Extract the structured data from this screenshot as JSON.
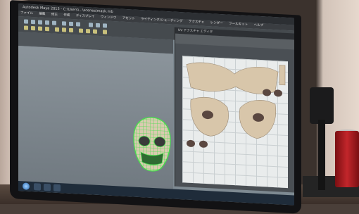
{
  "window": {
    "title": "Autodesk Maya 2013 - C:\\Users\\...\\scenes\\mask.mb",
    "uv_title": "UV テクスチャ エディタ"
  },
  "menubar": {
    "items": [
      "ファイル",
      "編集",
      "修正",
      "作成",
      "ディスプレイ",
      "ウィンドウ",
      "アセット",
      "ライティング/シェーディング",
      "テクスチャ",
      "レンダー",
      "ツールキット",
      "ヘルプ"
    ]
  },
  "colors": {
    "wireframe_selection": "#44e04a",
    "mask_base": "#d9cbb0",
    "uv_background": "#e9ecec",
    "uv_shell": "#d8c6aa"
  },
  "icons": {
    "start": "windows-start-icon"
  }
}
